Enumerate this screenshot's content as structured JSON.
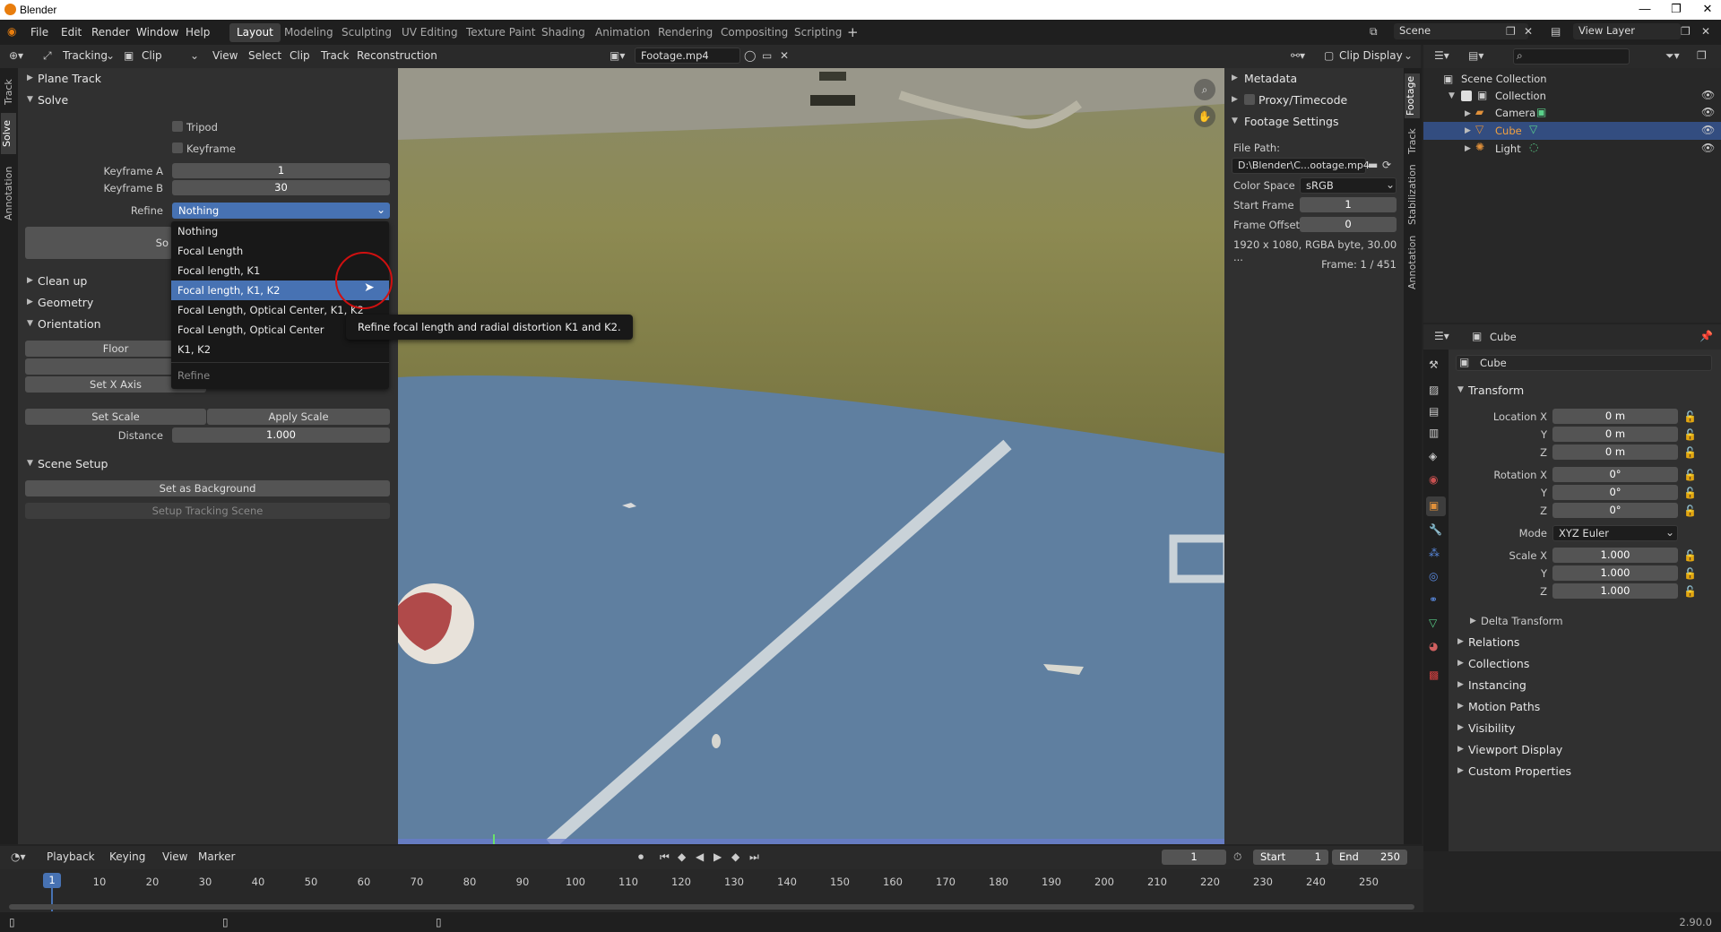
{
  "app": {
    "title": "Blender",
    "version": "2.90.0"
  },
  "menus": [
    "File",
    "Edit",
    "Render",
    "Window",
    "Help"
  ],
  "workspaces": [
    "Layout",
    "Modeling",
    "Sculpting",
    "UV Editing",
    "Texture Paint",
    "Shading",
    "Animation",
    "Rendering",
    "Compositing",
    "Scripting"
  ],
  "scene": "Scene",
  "view_layer": "View Layer",
  "clip_header": {
    "mode": "Tracking",
    "view": "Clip",
    "menus": [
      "View",
      "Select",
      "Clip",
      "Track",
      "Reconstruction"
    ],
    "clip_name": "Footage.mp4",
    "display": "Clip Display"
  },
  "left_tabs": [
    "Track",
    "Solve",
    "Annotation"
  ],
  "left_panel": {
    "plane_track": "Plane Track",
    "solve": "Solve",
    "tripod": "Tripod",
    "keyframe": "Keyframe",
    "keyframe_a_label": "Keyframe A",
    "keyframe_a": "1",
    "keyframe_b_label": "Keyframe B",
    "keyframe_b": "30",
    "refine_label": "Refine",
    "refine_value": "Nothing",
    "solve_btn": "So",
    "clean_up": "Clean up",
    "geometry": "Geometry",
    "orientation": "Orientation",
    "floor": "Floor",
    "set_x_axis": "Set X Axis",
    "set_scale": "Set Scale",
    "apply_scale": "Apply Scale",
    "distance_label": "Distance",
    "distance": "1.000",
    "scene_setup": "Scene Setup",
    "set_as_background": "Set as Background",
    "setup_tracking_scene": "Setup Tracking Scene"
  },
  "dropdown": {
    "items": [
      "Nothing",
      "Focal Length",
      "Focal length, K1",
      "Focal length, K1, K2",
      "Focal Length, Optical Center, K1, K2",
      "Focal Length, Optical Center",
      "K1, K2"
    ],
    "highlighted_index": 3,
    "footer": "Refine",
    "tooltip": "Refine focal length and radial distortion K1 and K2."
  },
  "footage_panel": {
    "metadata": "Metadata",
    "proxy": "Proxy/Timecode",
    "footage_settings": "Footage Settings",
    "file_path_label": "File Path:",
    "file_path": "D:\\Blender\\C...ootage.mp4",
    "color_space_label": "Color Space",
    "color_space": "sRGB",
    "start_frame_label": "Start Frame",
    "start_frame": "1",
    "frame_offset_label": "Frame Offset",
    "frame_offset": "0",
    "info": "1920 x 1080, RGBA byte, 30.00 ...",
    "frame_info": "Frame: 1 / 451"
  },
  "right_tabs": [
    "Footage",
    "Track",
    "Stabilization",
    "Annotation"
  ],
  "outliner": {
    "scene_collection": "Scene Collection",
    "collection": "Collection",
    "camera": "Camera",
    "cube": "Cube",
    "light": "Light"
  },
  "properties": {
    "header_object": "Cube",
    "object_name": "Cube",
    "transform": "Transform",
    "location_x_label": "Location X",
    "y_label": "Y",
    "z_label": "Z",
    "location": [
      "0 m",
      "0 m",
      "0 m"
    ],
    "rotation_x_label": "Rotation X",
    "rotation": [
      "0°",
      "0°",
      "0°"
    ],
    "mode_label": "Mode",
    "mode": "XYZ Euler",
    "scale_x_label": "Scale X",
    "scale": [
      "1.000",
      "1.000",
      "1.000"
    ],
    "delta_transform": "Delta Transform",
    "sections": [
      "Relations",
      "Collections",
      "Instancing",
      "Motion Paths",
      "Visibility",
      "Viewport Display",
      "Custom Properties"
    ]
  },
  "timeline": {
    "menus": [
      "Playback",
      "Keying",
      "View",
      "Marker"
    ],
    "current_frame": "1",
    "start_label": "Start",
    "start": "1",
    "end_label": "End",
    "end": "250",
    "ticks": [
      "10",
      "20",
      "30",
      "40",
      "50",
      "60",
      "70",
      "80",
      "90",
      "100",
      "110",
      "120",
      "130",
      "140",
      "150",
      "160",
      "170",
      "180",
      "190",
      "200",
      "210",
      "220",
      "230",
      "240",
      "250"
    ]
  }
}
